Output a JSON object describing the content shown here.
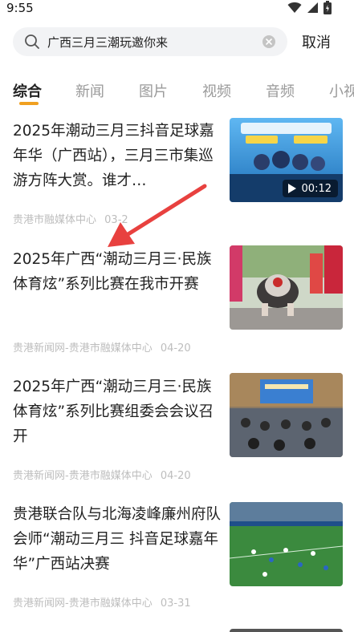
{
  "status_bar": {
    "time": "9:55",
    "icons": [
      "wifi-icon",
      "signal-icon",
      "battery-icon"
    ]
  },
  "search": {
    "query": "广西三月三潮玩邀你来",
    "cancel_label": "取消"
  },
  "tabs": [
    {
      "label": "综合",
      "active": true
    },
    {
      "label": "新闻",
      "active": false
    },
    {
      "label": "图片",
      "active": false
    },
    {
      "label": "视频",
      "active": false
    },
    {
      "label": "音频",
      "active": false
    },
    {
      "label": "小视",
      "active": false
    }
  ],
  "accent_color": "#f0a020",
  "news": [
    {
      "title": "2025年潮动三月三抖音足球嘉年华（广西站），三月三市集巡游方阵大赏。谁才…",
      "source": "贵港市融媒体中心",
      "date": "03-2",
      "thumb": "video-thumbnail",
      "duration": "00:12"
    },
    {
      "title": "2025年广西“潮动三月三·民族体育炫”系列比赛在我市开赛",
      "source": "贵港新闻网-贵港市融媒体中心",
      "date": "04-20",
      "thumb": "lion-dance-photo"
    },
    {
      "title": "2025年广西“潮动三月三·民族体育炫”系列比赛组委会会议召开",
      "source": "贵港新闻网-贵港市融媒体中心",
      "date": "04-20",
      "thumb": "meeting-photo"
    },
    {
      "title": "贵港联合队与北海凌峰廉州府队会师“潮动三月三 抖音足球嘉年华”广西站决赛",
      "source": "贵港新闻网-贵港市融媒体中心",
      "date": "03-31",
      "thumb": "football-photo"
    }
  ]
}
